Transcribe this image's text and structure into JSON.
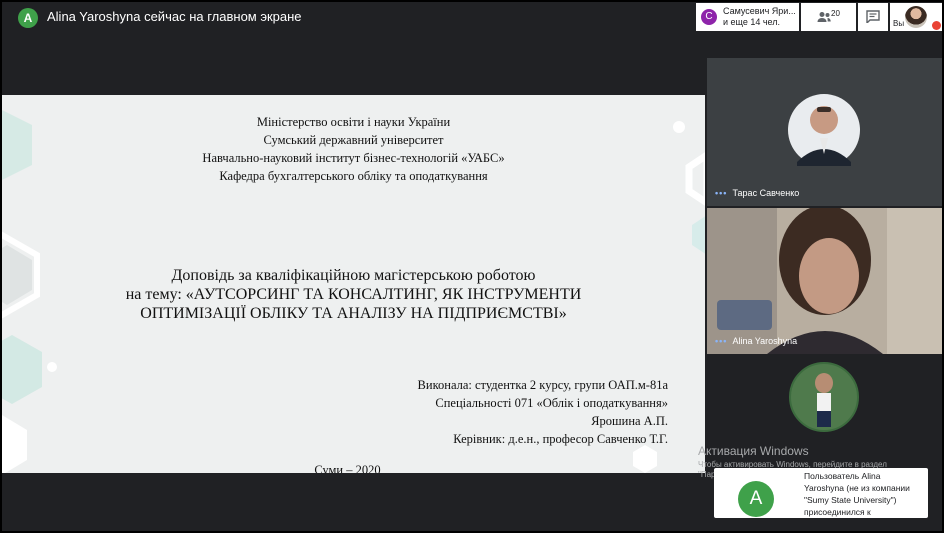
{
  "presenter": {
    "avatar_letter": "A",
    "text": "Alina Yaroshyna сейчас на главном экране"
  },
  "top_controls": {
    "participants_avatar_letter": "С",
    "participants_names": "Самусевич Яри...",
    "participants_more": "и еще 14 чел.",
    "people_icon": "people-icon",
    "people_count": "20",
    "chat_icon": "chat-icon",
    "self_label": "Вы",
    "mic_off_icon": "mic-off-icon"
  },
  "slide": {
    "header_lines": [
      "Міністерство освіти і науки України",
      "Сумський державний університет",
      "Навчально-науковий інститут бізнес-технологій «УАБС»",
      "Кафедра бухгалтерського обліку та оподаткування"
    ],
    "title_lines": [
      "Доповідь за кваліфікаційною магістерською роботою",
      "на тему: «АУТСОРСИНГ ТА КОНСАЛТИНГ, ЯК ІНСТРУМЕНТИ",
      "ОПТИМІЗАЦІЇ ОБЛІКУ ТА АНАЛІЗУ НА ПІДПРИЄМСТВІ»"
    ],
    "author_lines": [
      "Виконала: студентка 2 курсу, групи ОАП.м-81а",
      "Спеціальності 071 «Облік і оподаткування»",
      "Ярошина А.П.",
      "Керівник: д.е.н., професор Савченко Т.Г."
    ],
    "footer": "Суми – 2020"
  },
  "tiles": [
    {
      "name": "Тарас Савченко",
      "dots": "•••"
    },
    {
      "name": "Alina Yaroshyna",
      "dots": "•••"
    }
  ],
  "windows_activation": {
    "title": "Активация Windows",
    "subtitle": "Чтобы активировать Windows, перейдите в раздел \"Параметры\"."
  },
  "toast": {
    "avatar_letter": "A",
    "text": "Пользователь Alina Yaroshyna (не из компании \"Sumy State University\") присоединился к"
  },
  "colors": {
    "background": "#202124",
    "avatar_green": "#3fa14a",
    "chip_avatar_purple": "#8e24aa",
    "speaking_dots": "#8ab4f8",
    "mic_off_red": "#ea4335"
  }
}
